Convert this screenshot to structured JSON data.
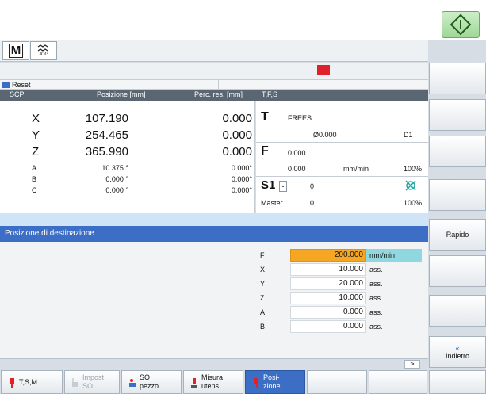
{
  "header": {
    "mode_icon_main": "M",
    "mode_icon_jog": "JOG"
  },
  "status": {
    "reset_label": "Reset"
  },
  "axes_table": {
    "headers": [
      "SCP",
      "Posizione [mm]",
      "Perc. res. [mm]",
      "T,F,S"
    ],
    "rows": [
      {
        "axis": "X",
        "position": "107.190",
        "distance": "0.000"
      },
      {
        "axis": "Y",
        "position": "254.465",
        "distance": "0.000"
      },
      {
        "axis": "Z",
        "position": "365.990",
        "distance": "0.000"
      },
      {
        "axis": "A",
        "position": "10.375 °",
        "distance": "0.000°"
      },
      {
        "axis": "B",
        "position": "0.000 °",
        "distance": "0.000°"
      },
      {
        "axis": "C",
        "position": "0.000 °",
        "distance": "0.000°"
      }
    ]
  },
  "tfs": {
    "tool_letter": "T",
    "tool_name": "FREES",
    "tool_diameter": "Ø0.000",
    "tool_d": "D1",
    "feed_letter": "F",
    "feed_value": "0.000",
    "feed_actual": "0.000",
    "feed_unit": "mm/min",
    "feed_override": "100%",
    "spindle_label": "S1",
    "spindle_value": "0",
    "spindle_master": "Master",
    "spindle_actual": "0",
    "spindle_override": "100%",
    "spindle_icon": "spindle-stop-icon"
  },
  "target": {
    "title": "Posizione di destinazione",
    "fields": [
      {
        "label": "F",
        "value": "200.000",
        "unit": "mm/min"
      },
      {
        "label": "X",
        "value": "10.000",
        "unit": "ass."
      },
      {
        "label": "Y",
        "value": "20.000",
        "unit": "ass."
      },
      {
        "label": "Z",
        "value": "10.000",
        "unit": "ass."
      },
      {
        "label": "A",
        "value": "0.000",
        "unit": "ass."
      },
      {
        "label": "B",
        "value": "0.000",
        "unit": "ass."
      }
    ]
  },
  "scroll_indicator": ">",
  "vertical_softkeys": [
    {
      "label": ""
    },
    {
      "label": ""
    },
    {
      "label": ""
    },
    {
      "label": ""
    },
    {
      "label": "Rapido"
    },
    {
      "label": ""
    },
    {
      "label": ""
    },
    {
      "label": ""
    },
    {
      "label_arrow": "«",
      "label": "Indietro"
    }
  ],
  "horizontal_softkeys": [
    {
      "label_1": "T,S,M",
      "label_2": ""
    },
    {
      "label_1": "Impost",
      "label_2": "SO"
    },
    {
      "label_1": "SO",
      "label_2": "pezzo"
    },
    {
      "label_1": "Misura",
      "label_2": "utens."
    },
    {
      "label_1": "Posi-",
      "label_2": "zione"
    }
  ],
  "colors": {
    "title_bar": "#3b6ec4",
    "active_softkey": "#3b6ec4",
    "highlight_field": "#f5a623",
    "unit_highlight": "#8fd8e0",
    "reset_blue": "#3b6ec4",
    "alarm_red": "#e0202a"
  }
}
